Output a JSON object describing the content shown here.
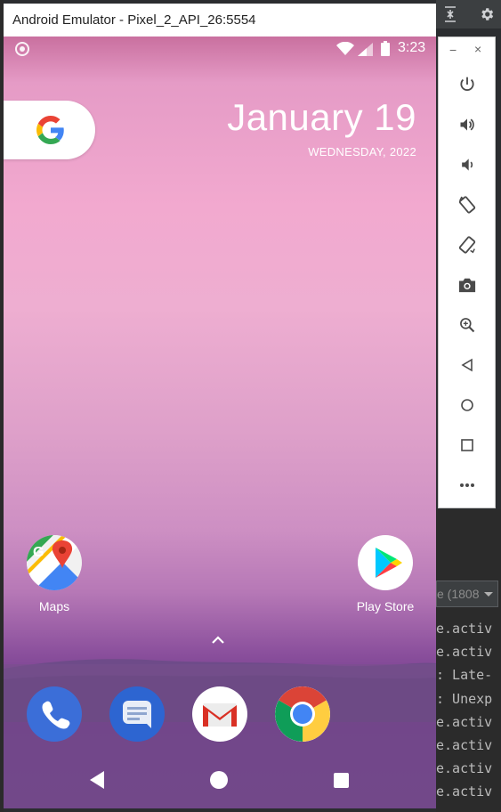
{
  "window": {
    "title": "Android Emulator - Pixel_2_API_26:5554"
  },
  "status_bar": {
    "time": "3:23"
  },
  "date_widget": {
    "date": "January 19",
    "weekday_year": "WEDNESDAY, 2022"
  },
  "home_apps": [
    {
      "label": "Maps"
    },
    {
      "label": "Play Store"
    }
  ],
  "dock": [
    "phone-icon",
    "messages-icon",
    "gmail-icon",
    "chrome-icon"
  ],
  "toolbar": {
    "minimize": "−",
    "close": "×"
  },
  "ide": {
    "dropdown_text": "e (1808",
    "log_lines": [
      "e.activ",
      "e.activ",
      ": Late-",
      ": Unexp",
      "e.activ",
      "e.activ",
      "e.activ",
      "e.activ"
    ]
  }
}
